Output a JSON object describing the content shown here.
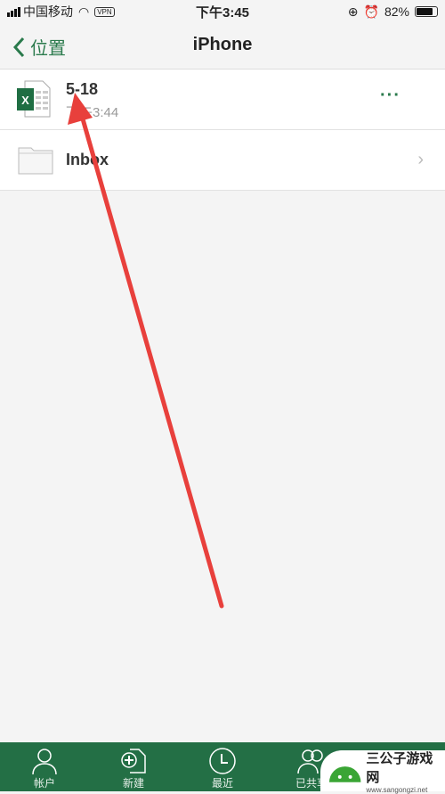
{
  "status_bar": {
    "carrier": "中国移动",
    "vpn": "VPN",
    "time": "下午3:45",
    "battery": "82%",
    "battery_level": 0.82
  },
  "nav": {
    "back_label": "位置",
    "title": "iPhone"
  },
  "files": [
    {
      "name": "5-18",
      "subtitle": "下午3:44",
      "icon": "excel-icon",
      "action": "···"
    },
    {
      "name": "Inbox",
      "icon": "folder-icon"
    }
  ],
  "tabbar": {
    "items": [
      {
        "label": "帐户",
        "icon": "person-icon"
      },
      {
        "label": "新建",
        "icon": "new-document-icon"
      },
      {
        "label": "最近",
        "icon": "clock-icon"
      },
      {
        "label": "已共享",
        "icon": "people-icon"
      }
    ]
  },
  "watermark": {
    "title": "三公子游戏网",
    "url": "www.sangongzi.net"
  },
  "colors": {
    "accent": "#2a7a4c",
    "tabbar": "#236f45",
    "annotation_arrow": "#e8403c"
  }
}
